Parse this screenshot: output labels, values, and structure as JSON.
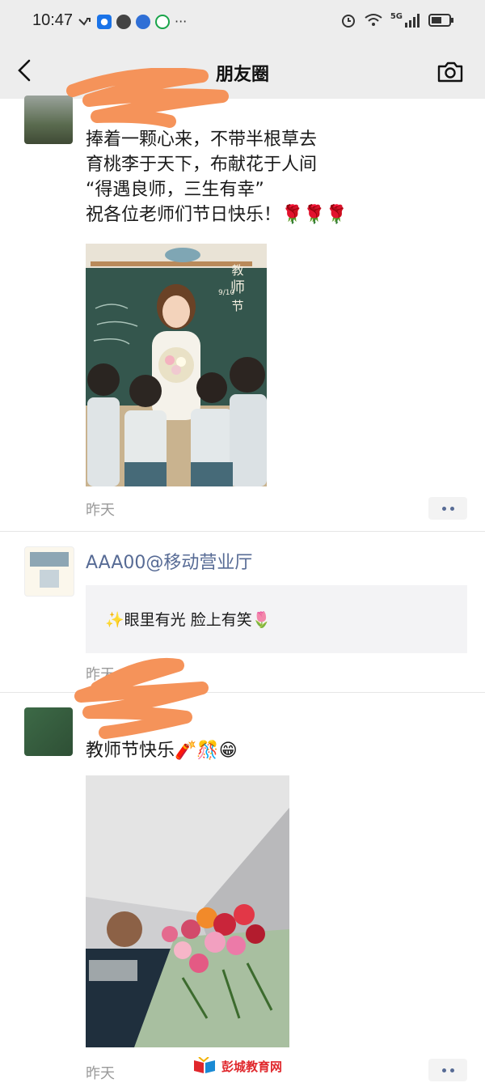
{
  "status_bar": {
    "time": "10:47",
    "network": "5G"
  },
  "nav": {
    "title": "朋友圈"
  },
  "posts": [
    {
      "text": "捧着一颗心来，不带半根草去\n育桃李于天下，布献花于人间\n“得遇良师，三生有幸”\n祝各位老师们节日快乐！🌹🌹🌹",
      "image_poster": {
        "title_chars": [
          "教",
          "师",
          "节"
        ],
        "date": "9/10"
      },
      "time": "昨天"
    },
    {
      "name": "AAA00@移动营业厅",
      "share_text": "✨眼里有光 脸上有笑🌷",
      "time": "昨天"
    },
    {
      "text": "教师节快乐🧨🎊😁",
      "time": "昨天"
    }
  ],
  "watermark": "彭城教育网",
  "colors": {
    "link": "#576b95",
    "bar": "#ededed",
    "redaction": "#f5935a"
  }
}
